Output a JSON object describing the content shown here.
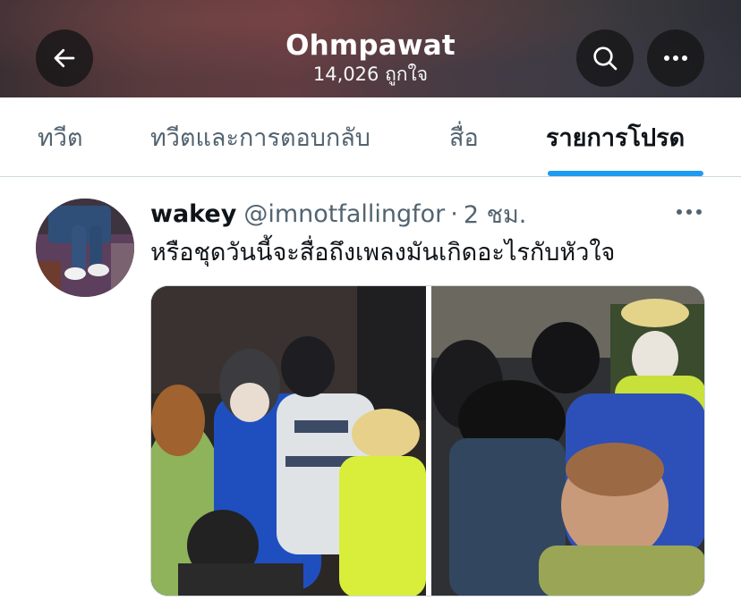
{
  "header": {
    "title": "Ohmpawat",
    "subtitle": "14,026 ถูกใจ",
    "back_icon": "arrow-left-icon",
    "search_icon": "search-icon",
    "more_icon": "more-horizontal-icon"
  },
  "tabs": [
    {
      "label": "ทวีต",
      "active": false
    },
    {
      "label": "ทวีตและการตอบกลับ",
      "active": false
    },
    {
      "label": "สื่อ",
      "active": false
    },
    {
      "label": "รายการโปรด",
      "active": true
    }
  ],
  "colors": {
    "accent": "#1d9bf0",
    "text_primary": "#0f1419",
    "text_secondary": "#536471",
    "divider": "#cfd9de"
  },
  "tweet": {
    "display_name": "wakey",
    "handle": "@imnotfallingfor",
    "separator": "·",
    "time": "2 ชม.",
    "text": "หรือชุดวันนี้จะสื่อถึงเพลงมันเกิดอะไรกับหัวใจ",
    "more_icon": "more-horizontal-icon",
    "media_count": 2
  }
}
